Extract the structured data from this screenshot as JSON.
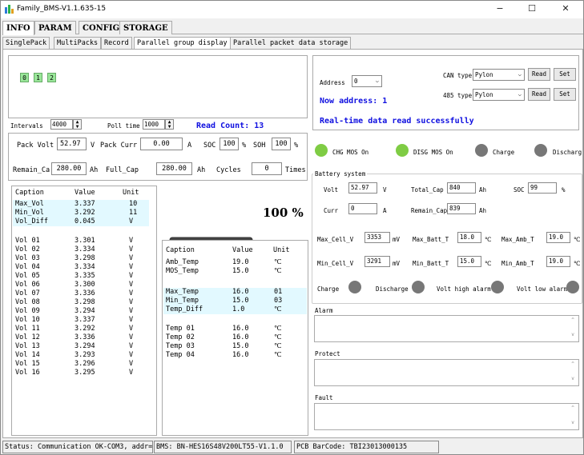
{
  "window": {
    "title": "Family_BMS-V1.1.635-15",
    "minimize": "−",
    "maximize": "☐",
    "close": "✕"
  },
  "main_tabs": [
    "INFO",
    "PARAM",
    "CONFIG",
    "STORAGE"
  ],
  "sub_tabs": [
    "SinglePack",
    "MultiPacks",
    "Record",
    "Parallel group display",
    "Parallel packet data storage"
  ],
  "groups": [
    "0",
    "1",
    "2"
  ],
  "poll": {
    "intervals_label": "Intervals",
    "intervals": "4000",
    "poll_time_label": "Poll time",
    "poll_time": "1000",
    "read_count": "Read Count: 13"
  },
  "pack": {
    "volt_label": "Pack Volt",
    "volt": "52.97",
    "volt_unit": "V",
    "curr_label": "Pack Curr",
    "curr": "0.00",
    "curr_unit": "A",
    "soc_label": "SOC",
    "soc": "100",
    "soc_unit": "%",
    "soh_label": "SOH",
    "soh": "100",
    "soh_unit": "%",
    "remain_label": "Remain_Ca",
    "remain": "280.00",
    "remain_unit": "Ah",
    "full_label": "Full_Cap",
    "full": "280.00",
    "full_unit": "Ah",
    "cycles_label": "Cycles",
    "cycles": "0",
    "cycles_unit": "Times"
  },
  "volt_table": {
    "headers": [
      "Caption",
      "Value",
      "Unit"
    ],
    "summary": [
      [
        "Max_Vol",
        "3.337",
        "10"
      ],
      [
        "Min_Vol",
        "3.292",
        "11"
      ],
      [
        "Vol_Diff",
        "0.045",
        "V"
      ]
    ],
    "cells": [
      [
        "Vol 01",
        "3.301",
        "V"
      ],
      [
        "Vol 02",
        "3.334",
        "V"
      ],
      [
        "Vol 03",
        "3.298",
        "V"
      ],
      [
        "Vol 04",
        "3.334",
        "V"
      ],
      [
        "Vol 05",
        "3.335",
        "V"
      ],
      [
        "Vol 06",
        "3.300",
        "V"
      ],
      [
        "Vol 07",
        "3.336",
        "V"
      ],
      [
        "Vol 08",
        "3.298",
        "V"
      ],
      [
        "Vol 09",
        "3.294",
        "V"
      ],
      [
        "Vol 10",
        "3.337",
        "V"
      ],
      [
        "Vol 11",
        "3.292",
        "V"
      ],
      [
        "Vol 12",
        "3.336",
        "V"
      ],
      [
        "Vol 13",
        "3.294",
        "V"
      ],
      [
        "Vol 14",
        "3.293",
        "V"
      ],
      [
        "Vol 15",
        "3.296",
        "V"
      ],
      [
        "Vol 16",
        "3.295",
        "V"
      ]
    ]
  },
  "battery": {
    "percent_label": "100 %",
    "level": 1.0
  },
  "temp_table": {
    "headers": [
      "Caption",
      "Value",
      "Unit"
    ],
    "group1": [
      [
        "Amb_Temp",
        "19.0",
        "℃"
      ],
      [
        "MOS_Temp",
        "15.0",
        "℃"
      ]
    ],
    "group2": [
      [
        "Max_Temp",
        "16.0",
        "01"
      ],
      [
        "Min_Temp",
        "15.0",
        "03"
      ],
      [
        "Temp_Diff",
        "1.0",
        "℃"
      ]
    ],
    "group3": [
      [
        "Temp 01",
        "16.0",
        "℃"
      ],
      [
        "Temp 02",
        "16.0",
        "℃"
      ],
      [
        "Temp 03",
        "15.0",
        "℃"
      ],
      [
        "Temp 04",
        "16.0",
        "℃"
      ]
    ]
  },
  "address": {
    "label": "Address",
    "value": "0",
    "now": "Now address: 1",
    "status": "Real-time data read successfully"
  },
  "can": {
    "label": "CAN type",
    "value": "Pylon",
    "read": "Read",
    "set": "Set"
  },
  "rs485": {
    "label": "485 type",
    "value": "Pylon",
    "read": "Read",
    "set": "Set"
  },
  "indicators": [
    {
      "label": "CHG MOS On",
      "color": "#7fcc44"
    },
    {
      "label": "DISG MOS On",
      "color": "#7fcc44"
    },
    {
      "label": "Charge",
      "color": "#777777"
    },
    {
      "label": "Discharg",
      "color": "#777777"
    }
  ],
  "system": {
    "title": "Battery system",
    "volt_label": "Volt",
    "volt": "52.97",
    "volt_unit": "V",
    "total_cap_label": "Total_Cap",
    "total_cap": "840",
    "total_cap_unit": "Ah",
    "soc_label": "SOC",
    "soc": "99",
    "soc_unit": "%",
    "curr_label": "Curr",
    "curr": "0",
    "curr_unit": "A",
    "remain_cap_label": "Remain_Cap",
    "remain_cap": "839",
    "remain_cap_unit": "Ah",
    "max_cell_label": "Max_Cell_V",
    "max_cell": "3353",
    "mv": "mV",
    "max_batt_t_label": "Max_Batt_T",
    "max_batt_t": "18.0",
    "max_amb_t_label": "Max_Amb_T",
    "max_amb_t": "19.0",
    "min_cell_label": "Min_Cell_V",
    "min_cell": "3291",
    "min_batt_t_label": "Min_Batt_T",
    "min_batt_t": "15.0",
    "min_amb_t_label": "Min_Amb_T",
    "min_amb_t": "19.0",
    "deg": "℃",
    "alarms": [
      "Charge",
      "Discharge",
      "Volt high alarm",
      "Volt low alarm"
    ]
  },
  "sections": {
    "alarm": "Alarm",
    "protect": "Protect",
    "fault": "Fault"
  },
  "status_bar": {
    "comm": "Status: Communication OK-COM3, addr=0",
    "bms": "BMS: BN-HES16S48V200LT55-V1.1.0",
    "barcode": "PCB BarCode: TBI23013000135"
  },
  "colors": {
    "accent_blue": "#1010e0",
    "row_highlight": "#e2f9ff",
    "group_green": "#99e699",
    "battery_green": "#8dd62e"
  }
}
